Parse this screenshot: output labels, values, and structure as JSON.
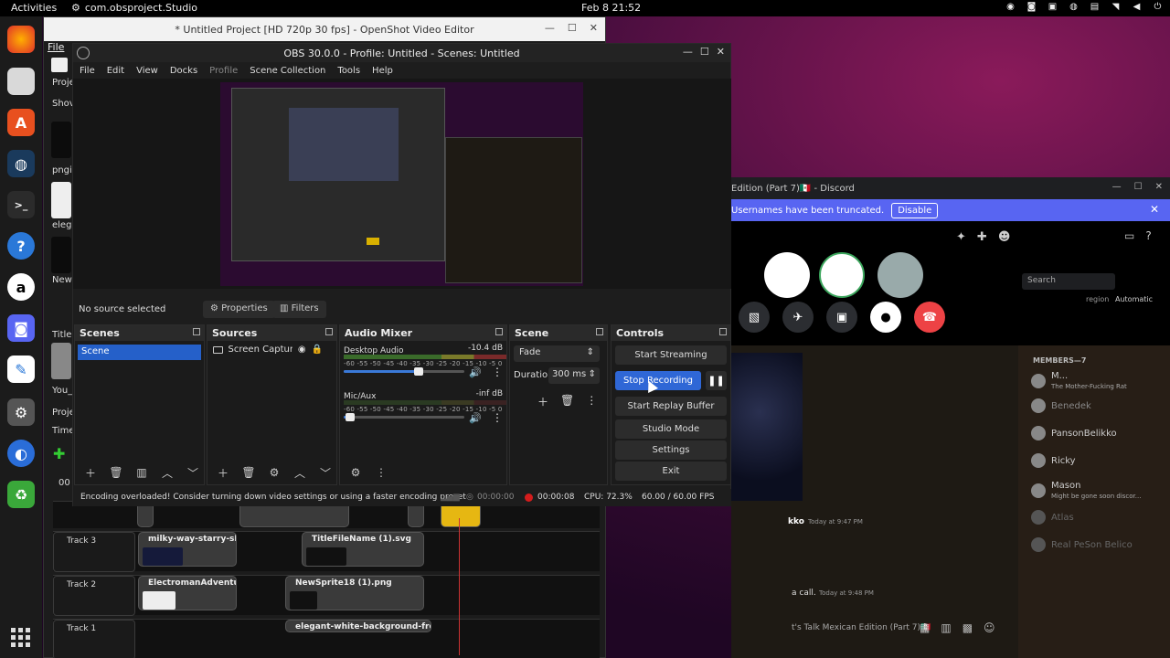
{
  "topbar": {
    "activities": "Activities",
    "app": "com.obsproject.Studio",
    "clock": "Feb 8  21:52"
  },
  "openshot": {
    "title": "* Untitled Project [HD 720p 30 fps] - OpenShot Video Editor",
    "menu_file": "File",
    "left_labels": [
      "Projec",
      "Shov",
      "pngi",
      "elega",
      "New",
      "Title",
      "You_",
      "Proje",
      "Timeli",
      "00"
    ],
    "tracks": [
      {
        "label": "Track 3",
        "clips": [
          "milky-way-starry-sky-n...",
          "TitleFileName (1).svg"
        ]
      },
      {
        "label": "Track 2",
        "clips": [
          "ElectromanAdventure...",
          "NewSprite18 (1).png"
        ]
      },
      {
        "label": "Track 1",
        "clips": [
          "elegant-white-background-free-vect..."
        ]
      }
    ]
  },
  "discord": {
    "title": "Edition (Part 7)🇲🇽 - Discord",
    "banner_text": "Usernames have been truncated.",
    "banner_button": "Disable",
    "search_placeholder": "Search",
    "region_label": "region",
    "region_value": "Automatic",
    "members_header": "MEMBERS—7",
    "members": [
      {
        "name": "M...",
        "status": "The Mother-Fucking Rat"
      },
      {
        "name": "Benedek",
        "status": ""
      },
      {
        "name": "PansonBelikko",
        "status": ""
      },
      {
        "name": "Ricky",
        "status": ""
      },
      {
        "name": "Mason",
        "status": "Might be gone soon discor..."
      },
      {
        "name": "Atlas",
        "status": ""
      },
      {
        "name": "Real PeSon Belico",
        "status": ""
      }
    ],
    "chat": [
      {
        "author": "kko",
        "time": "Today at 9:47 PM"
      },
      {
        "author": "a call.",
        "time": "Today at 9:48 PM"
      }
    ],
    "composer": "t's Talk Mexican Edition (Part 7)🇲🇽"
  },
  "obs": {
    "title": "OBS 30.0.0 - Profile: Untitled - Scenes: Untitled",
    "menu": [
      "File",
      "Edit",
      "View",
      "Docks",
      "Profile",
      "Scene Collection",
      "Tools",
      "Help"
    ],
    "no_source": "No source selected",
    "properties": "Properties",
    "filters": "Filters",
    "docks": {
      "scenes": "Scenes",
      "sources": "Sources",
      "audio_mixer": "Audio Mixer",
      "scene_transitions": "Scene Transitions",
      "controls": "Controls"
    },
    "scenes": [
      "Scene"
    ],
    "sources": [
      "Screen Capture (Pi"
    ],
    "mixer": [
      {
        "name": "Desktop Audio",
        "db": "-10.4 dB",
        "volume": 0.62
      },
      {
        "name": "Mic/Aux",
        "db": "-inf dB",
        "volume": 0.05
      }
    ],
    "meter_scale": "-60 -55 -50 -45 -40 -35 -30 -25 -20 -15 -10 -5 0",
    "transition": "Fade",
    "duration_label": "Duration",
    "duration_value": "300 ms",
    "controls": {
      "start_streaming": "Start Streaming",
      "stop_recording": "Stop Recording",
      "start_replay": "Start Replay Buffer",
      "studio_mode": "Studio Mode",
      "settings": "Settings",
      "exit": "Exit"
    },
    "status": {
      "message": "Encoding overloaded! Consider turning down video settings or using a faster encoding preset",
      "stream_time": "00:00:00",
      "rec_time": "00:00:08",
      "cpu": "CPU: 72.3%",
      "fps": "60.00 / 60.00 FPS"
    }
  }
}
